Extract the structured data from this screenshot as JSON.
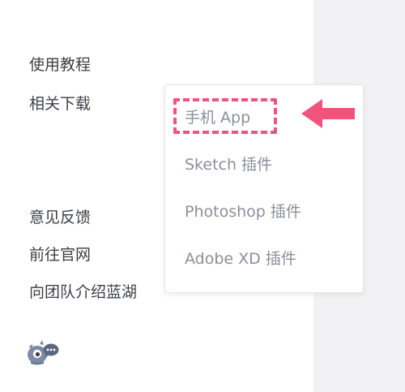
{
  "sidebar": {
    "items": [
      {
        "label": "使用教程"
      },
      {
        "label": "相关下载"
      },
      {
        "label": "意见反馈"
      },
      {
        "label": "前往官网"
      },
      {
        "label": "向团队介绍蓝湖"
      }
    ]
  },
  "download_menu": {
    "items": [
      {
        "label": "手机 App",
        "highlighted": true
      },
      {
        "label": "Sketch 插件"
      },
      {
        "label": "Photoshop 插件"
      },
      {
        "label": "Adobe XD 插件"
      }
    ]
  },
  "colors": {
    "highlight": "#f2537a",
    "menu_text": "#3d4046",
    "submenu_text": "#8a8f99",
    "right_panel": "#f2f2f4"
  },
  "icons": {
    "arrow": "left-arrow-icon",
    "logo": "mascot-chat-icon"
  }
}
